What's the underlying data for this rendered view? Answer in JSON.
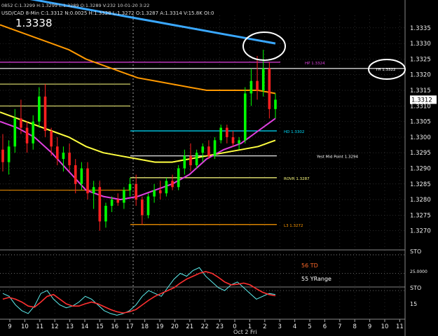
{
  "header": {
    "info": "0852 C:1.3299 H:1.3299 L:1.3289 O:1.3289 V:232 10-01-20 3:22",
    "symbol_line": "USD/CAD 8-Min C:1.3312 N:0.0025 H:1.3328 L:1.3272 O:1.3287 A:1.3314 V:15.8K OI:0",
    "big_price": "1.3338"
  },
  "colors": {
    "background": "#000000",
    "grid": "#444444",
    "up": "#00ff00",
    "down": "#ff2020",
    "sma_fast": "#5ff0f0",
    "sma_mid": "#e040e0",
    "sma_yellow": "#ffff40",
    "sma_orange": "#ff9900",
    "sma_blue": "#3aa8ff",
    "level_magenta": "#e040e0",
    "level_cyan": "#00e0ff",
    "level_yellow": "#ffff80",
    "level_orange": "#ff9900",
    "annotation": "#ffffff"
  },
  "chart_data": {
    "type": "candlestick",
    "title": "USD/CAD 8-Min",
    "ylim": [
      1.3265,
      1.3339
    ],
    "yticks": [
      "1.3335",
      "1.3330",
      "1.3325",
      "1.3320",
      "1.3315",
      "1.3310",
      "1.3305",
      "1.3300",
      "1.3295",
      "1.3290",
      "1.3285",
      "1.3280",
      "1.3275",
      "1.3270"
    ],
    "last_price": "1.3312",
    "x_ticks": [
      "9",
      "10",
      "11",
      "12",
      "13",
      "14",
      "15",
      "16",
      "17",
      "18",
      "19",
      "20",
      "21",
      "22",
      "23",
      "0",
      "1",
      "2",
      "3",
      "4",
      "5",
      "6",
      "7",
      "8",
      "9",
      "10",
      "11"
    ],
    "x_date_label": "Oct 2 Fri",
    "candles": [
      [
        1.3296,
        1.3301,
        1.3289,
        1.3292
      ],
      [
        1.3292,
        1.3299,
        1.3288,
        1.3297
      ],
      [
        1.3297,
        1.3309,
        1.3295,
        1.3306
      ],
      [
        1.3306,
        1.3312,
        1.3301,
        1.3303
      ],
      [
        1.3303,
        1.3305,
        1.3295,
        1.3298
      ],
      [
        1.3298,
        1.3307,
        1.3296,
        1.3305
      ],
      [
        1.3305,
        1.3316,
        1.3303,
        1.3313
      ],
      [
        1.3313,
        1.3317,
        1.33,
        1.3302
      ],
      [
        1.3302,
        1.3303,
        1.3294,
        1.3297
      ],
      [
        1.3297,
        1.33,
        1.3291,
        1.3293
      ],
      [
        1.3293,
        1.3297,
        1.3289,
        1.3295
      ],
      [
        1.3295,
        1.3298,
        1.3289,
        1.3291
      ],
      [
        1.3291,
        1.3293,
        1.3282,
        1.3285
      ],
      [
        1.3285,
        1.3292,
        1.3283,
        1.329
      ],
      [
        1.329,
        1.3292,
        1.328,
        1.3282
      ],
      [
        1.3282,
        1.3286,
        1.3277,
        1.3284
      ],
      [
        1.3284,
        1.3286,
        1.327,
        1.3273
      ],
      [
        1.3273,
        1.3279,
        1.3271,
        1.3278
      ],
      [
        1.3278,
        1.3281,
        1.3276,
        1.328
      ],
      [
        1.328,
        1.3282,
        1.3278,
        1.3279
      ],
      [
        1.3279,
        1.3284,
        1.3277,
        1.3283
      ],
      [
        1.3283,
        1.3287,
        1.3281,
        1.3285
      ],
      [
        1.3285,
        1.3288,
        1.3278,
        1.328
      ],
      [
        1.328,
        1.3281,
        1.3272,
        1.3275
      ],
      [
        1.3275,
        1.3282,
        1.3274,
        1.3281
      ],
      [
        1.3281,
        1.3285,
        1.3279,
        1.3283
      ],
      [
        1.3283,
        1.3286,
        1.328,
        1.3282
      ],
      [
        1.3282,
        1.3287,
        1.3281,
        1.3286
      ],
      [
        1.3286,
        1.3288,
        1.3283,
        1.3284
      ],
      [
        1.3284,
        1.3291,
        1.3283,
        1.329
      ],
      [
        1.329,
        1.3296,
        1.3288,
        1.3294
      ],
      [
        1.3294,
        1.3298,
        1.3289,
        1.3291
      ],
      [
        1.3291,
        1.3296,
        1.329,
        1.3295
      ],
      [
        1.3295,
        1.3298,
        1.3292,
        1.3297
      ],
      [
        1.3297,
        1.3299,
        1.3293,
        1.3294
      ],
      [
        1.3294,
        1.33,
        1.3293,
        1.3299
      ],
      [
        1.3299,
        1.3304,
        1.3298,
        1.3303
      ],
      [
        1.3303,
        1.3304,
        1.3298,
        1.33
      ],
      [
        1.33,
        1.3302,
        1.3297,
        1.3298
      ],
      [
        1.3298,
        1.33,
        1.3296,
        1.3299
      ],
      [
        1.3299,
        1.3316,
        1.3298,
        1.3314
      ],
      [
        1.3314,
        1.3322,
        1.331,
        1.3318
      ],
      [
        1.3318,
        1.3326,
        1.3312,
        1.3315
      ],
      [
        1.3315,
        1.3328,
        1.3313,
        1.3322
      ],
      [
        1.3322,
        1.3324,
        1.3306,
        1.3309
      ],
      [
        1.3309,
        1.3314,
        1.3306,
        1.3312
      ]
    ],
    "levels": [
      {
        "label": "HP 1.3324",
        "value": 1.3324,
        "color": "#e040e0"
      },
      {
        "label": "YH 1.3322",
        "value": 1.3322,
        "color": "#ffffff"
      },
      {
        "label": "HD 1.3302",
        "value": 1.3302,
        "color": "#00e0ff"
      },
      {
        "label": "Yest Mid Point 1.3294",
        "value": 1.3294,
        "color": "#ffffff"
      },
      {
        "label": "ROVR 1.3287",
        "value": 1.3287,
        "color": "#ffff80"
      },
      {
        "label": "L3 1.3272",
        "value": 1.3272,
        "color": "#ff9900"
      }
    ],
    "level_lines_left": [
      1.3317,
      1.331
    ],
    "moving_averages": [
      {
        "color": "#3aa8ff",
        "values": [
          1.3346,
          1.3345,
          1.3344,
          1.3343,
          1.3342,
          1.3341,
          1.334,
          1.3339,
          1.3338,
          1.3337,
          1.3336,
          1.3335,
          1.3334,
          1.3333,
          1.3332,
          1.3331,
          1.333
        ]
      },
      {
        "color": "#ff9900",
        "values": [
          1.3336,
          1.3334,
          1.3332,
          1.333,
          1.3328,
          1.3325,
          1.3323,
          1.3321,
          1.3319,
          1.3318,
          1.3317,
          1.3316,
          1.3315,
          1.3315,
          1.3315,
          1.3315,
          1.3314
        ]
      },
      {
        "color": "#ffff40",
        "values": [
          1.3308,
          1.3306,
          1.3304,
          1.3302,
          1.33,
          1.3297,
          1.3295,
          1.3294,
          1.3293,
          1.3292,
          1.3292,
          1.3293,
          1.3294,
          1.3295,
          1.3296,
          1.3297,
          1.3299
        ]
      },
      {
        "color": "#e040e0",
        "values": [
          1.3305,
          1.3303,
          1.33,
          1.3295,
          1.3289,
          1.3283,
          1.3281,
          1.328,
          1.3281,
          1.3283,
          1.3285,
          1.3288,
          1.3293,
          1.3296,
          1.3298,
          1.3302,
          1.3306
        ]
      }
    ],
    "stochastic": {
      "panel_label": "STO",
      "labels": [
        "56 TD",
        "55 YRange"
      ],
      "yticks": [
        "25.0000",
        "15"
      ],
      "k": [
        40,
        35,
        20,
        10,
        5,
        18,
        40,
        45,
        30,
        20,
        15,
        18,
        25,
        35,
        30,
        20,
        10,
        5,
        2,
        5,
        10,
        20,
        35,
        45,
        40,
        35,
        50,
        65,
        75,
        70,
        80,
        85,
        70,
        60,
        50,
        45,
        55,
        60,
        50,
        40,
        30,
        35,
        40,
        38
      ],
      "d": [
        30,
        33,
        30,
        25,
        18,
        16,
        25,
        35,
        38,
        30,
        22,
        18,
        18,
        22,
        25,
        22,
        17,
        12,
        8,
        6,
        8,
        12,
        20,
        28,
        35,
        40,
        45,
        50,
        58,
        65,
        70,
        75,
        78,
        75,
        68,
        60,
        55,
        56,
        58,
        55,
        48,
        42,
        38,
        36
      ]
    },
    "stochastic_right_ticks": [
      "STO",
      "25.0000",
      "STO",
      "15"
    ]
  }
}
